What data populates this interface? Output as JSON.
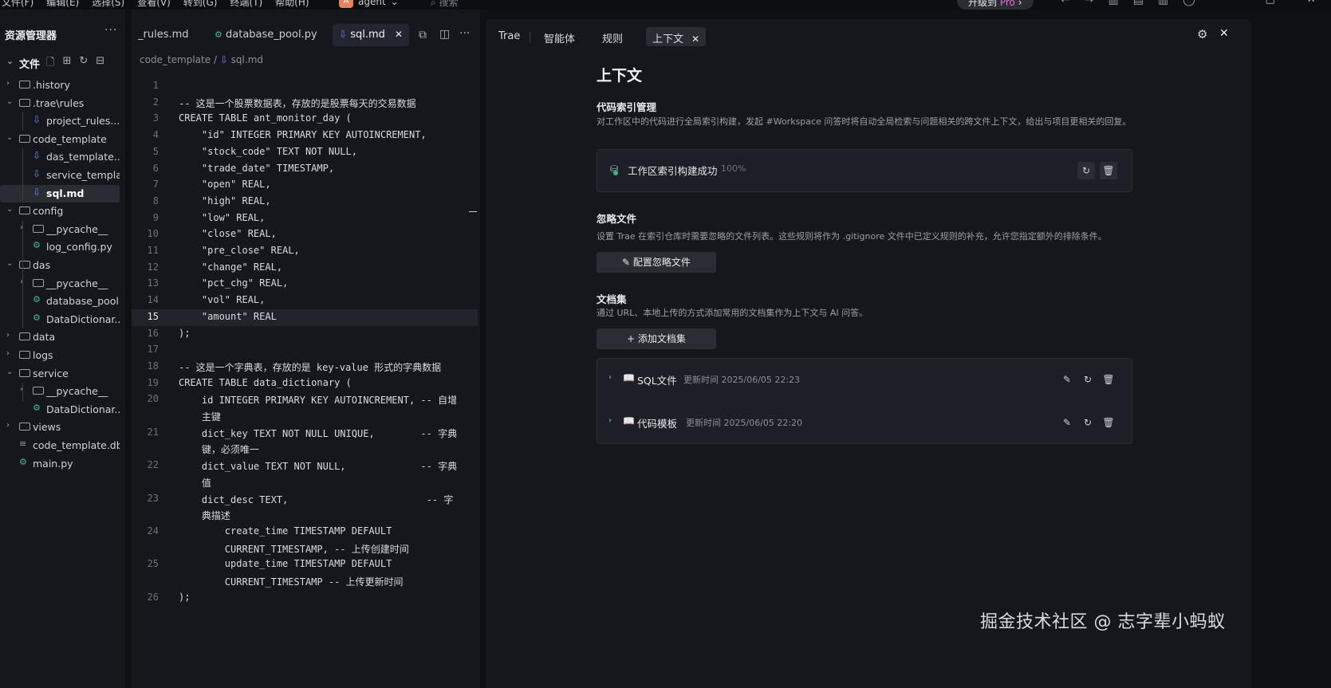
{
  "menubar": {
    "items": [
      "文件(F)",
      "编辑(E)",
      "选择(S)",
      "查看(V)",
      "转到(G)",
      "终端(T)",
      "帮助(H)"
    ],
    "project_badge": "A",
    "project_name": "agent",
    "search_placeholder": "搜索",
    "upgrade_label": "升级到",
    "upgrade_pro": "Pro"
  },
  "explorer": {
    "title": "资源管理器",
    "section": "文件",
    "tree": [
      {
        "name": ".history",
        "kind": "folder",
        "depth": 0,
        "expanded": false
      },
      {
        "name": ".trae\\rules",
        "kind": "folder",
        "depth": 0,
        "expanded": true
      },
      {
        "name": "project_rules....",
        "kind": "md",
        "depth": 1
      },
      {
        "name": "code_template",
        "kind": "folder",
        "depth": 0,
        "expanded": true
      },
      {
        "name": "das_template....",
        "kind": "md",
        "depth": 1
      },
      {
        "name": "service_templa...",
        "kind": "md",
        "depth": 1
      },
      {
        "name": "sql.md",
        "kind": "md",
        "depth": 1,
        "selected": true
      },
      {
        "name": "config",
        "kind": "folder",
        "depth": 0,
        "expanded": true
      },
      {
        "name": "__pycache__",
        "kind": "folder",
        "depth": 1,
        "expanded": false
      },
      {
        "name": "log_config.py",
        "kind": "py",
        "depth": 1
      },
      {
        "name": "das",
        "kind": "folder",
        "depth": 0,
        "expanded": true
      },
      {
        "name": "__pycache__",
        "kind": "folder",
        "depth": 1,
        "expanded": false
      },
      {
        "name": "database_pool...",
        "kind": "py",
        "depth": 1
      },
      {
        "name": "DataDictionar...",
        "kind": "py",
        "depth": 1
      },
      {
        "name": "data",
        "kind": "folder",
        "depth": 0,
        "expanded": false
      },
      {
        "name": "logs",
        "kind": "folder",
        "depth": 0,
        "expanded": false
      },
      {
        "name": "service",
        "kind": "folder",
        "depth": 0,
        "expanded": true
      },
      {
        "name": "__pycache__",
        "kind": "folder",
        "depth": 1,
        "expanded": false
      },
      {
        "name": "DataDictionar...",
        "kind": "py",
        "depth": 1
      },
      {
        "name": "views",
        "kind": "folder",
        "depth": 0,
        "expanded": false
      },
      {
        "name": "code_template.db",
        "kind": "db",
        "depth": 0
      },
      {
        "name": "main.py",
        "kind": "py",
        "depth": 0
      }
    ]
  },
  "editor": {
    "tabs": [
      {
        "label": "_rules.md",
        "kind": "md"
      },
      {
        "label": "database_pool.py",
        "kind": "py"
      },
      {
        "label": "sql.md",
        "kind": "md",
        "active": true
      }
    ],
    "breadcrumb": [
      "code_template",
      "sql.md"
    ],
    "current_line": 15,
    "lines": [
      {
        "n": "1",
        "rows": [
          ""
        ]
      },
      {
        "n": "2",
        "rows": [
          "-- 这是一个股票数据表，存放的是股票每天的交易数据"
        ]
      },
      {
        "n": "3",
        "rows": [
          "CREATE TABLE ant_monitor_day ("
        ]
      },
      {
        "n": "4",
        "rows": [
          "    \"id\" INTEGER PRIMARY KEY AUTOINCREMENT,"
        ]
      },
      {
        "n": "5",
        "rows": [
          "    \"stock_code\" TEXT NOT NULL,"
        ]
      },
      {
        "n": "6",
        "rows": [
          "    \"trade_date\" TIMESTAMP,"
        ]
      },
      {
        "n": "7",
        "rows": [
          "    \"open\" REAL,"
        ]
      },
      {
        "n": "8",
        "rows": [
          "    \"high\" REAL,"
        ]
      },
      {
        "n": "9",
        "rows": [
          "    \"low\" REAL,"
        ]
      },
      {
        "n": "10",
        "rows": [
          "    \"close\" REAL,"
        ]
      },
      {
        "n": "11",
        "rows": [
          "    \"pre_close\" REAL,"
        ]
      },
      {
        "n": "12",
        "rows": [
          "    \"change\" REAL,"
        ]
      },
      {
        "n": "13",
        "rows": [
          "    \"pct_chg\" REAL,"
        ]
      },
      {
        "n": "14",
        "rows": [
          "    \"vol\" REAL,"
        ]
      },
      {
        "n": "15",
        "rows": [
          "    \"amount\" REAL"
        ]
      },
      {
        "n": "16",
        "rows": [
          ");"
        ]
      },
      {
        "n": "17",
        "rows": [
          ""
        ]
      },
      {
        "n": "18",
        "rows": [
          "-- 这是一个字典表，存放的是 key-value 形式的字典数据"
        ]
      },
      {
        "n": "19",
        "rows": [
          "CREATE TABLE data_dictionary ("
        ]
      },
      {
        "n": "20",
        "rows": [
          "    id INTEGER PRIMARY KEY AUTOINCREMENT, -- 自增",
          "    主键"
        ]
      },
      {
        "n": "21",
        "rows": [
          "    dict_key TEXT NOT NULL UNIQUE,        -- 字典",
          "    键，必须唯一"
        ]
      },
      {
        "n": "22",
        "rows": [
          "    dict_value TEXT NOT NULL,             -- 字典",
          "    值"
        ]
      },
      {
        "n": "23",
        "rows": [
          "    dict_desc TEXT,                        -- 字",
          "    典描述"
        ]
      },
      {
        "n": "24",
        "rows": [
          "        create_time TIMESTAMP DEFAULT",
          "        CURRENT_TIMESTAMP, -- 上传创建时间"
        ]
      },
      {
        "n": "25",
        "rows": [
          "        update_time TIMESTAMP DEFAULT",
          "        CURRENT_TIMESTAMP -- 上传更新时间"
        ]
      },
      {
        "n": "26",
        "rows": [
          ");"
        ]
      }
    ]
  },
  "panel": {
    "tabs": [
      {
        "label": "Trae"
      },
      {
        "label": "智能体"
      },
      {
        "label": "规则"
      },
      {
        "label": "上下文",
        "active": true
      }
    ],
    "title": "上下文",
    "code_index": {
      "heading": "代码索引管理",
      "desc": "对工作区中的代码进行全局索引构建，发起 #Workspace 问答时将自动全局检索与问题相关的跨文件上下文，给出与项目更相关的回复。",
      "status": "工作区索引构建成功",
      "progress": "100%"
    },
    "ignore": {
      "heading": "忽略文件",
      "desc": "设置 Trae 在索引仓库时需要忽略的文件列表。这些规则将作为 .gitignore 文件中已定义规则的补充，允许您指定额外的排除条件。",
      "button": "配置忽略文件"
    },
    "docs": {
      "heading": "文档集",
      "desc": "通过 URL、本地上传的方式添加常用的文档集作为上下文与 AI 问答。",
      "button": "添加文档集",
      "items": [
        {
          "name": "SQL文件",
          "updated": "更新时间 2025/06/05 22:23"
        },
        {
          "name": "代码模板",
          "updated": "更新时间 2025/06/05 22:20"
        }
      ]
    }
  },
  "watermark": "掘金技术社区 @ 志字辈小蚂蚁",
  "colors": {
    "accent_md": "#5b8de8",
    "accent_py": "#3fb6a3",
    "pro": "#d96fd1",
    "badge": "#e6835a"
  }
}
